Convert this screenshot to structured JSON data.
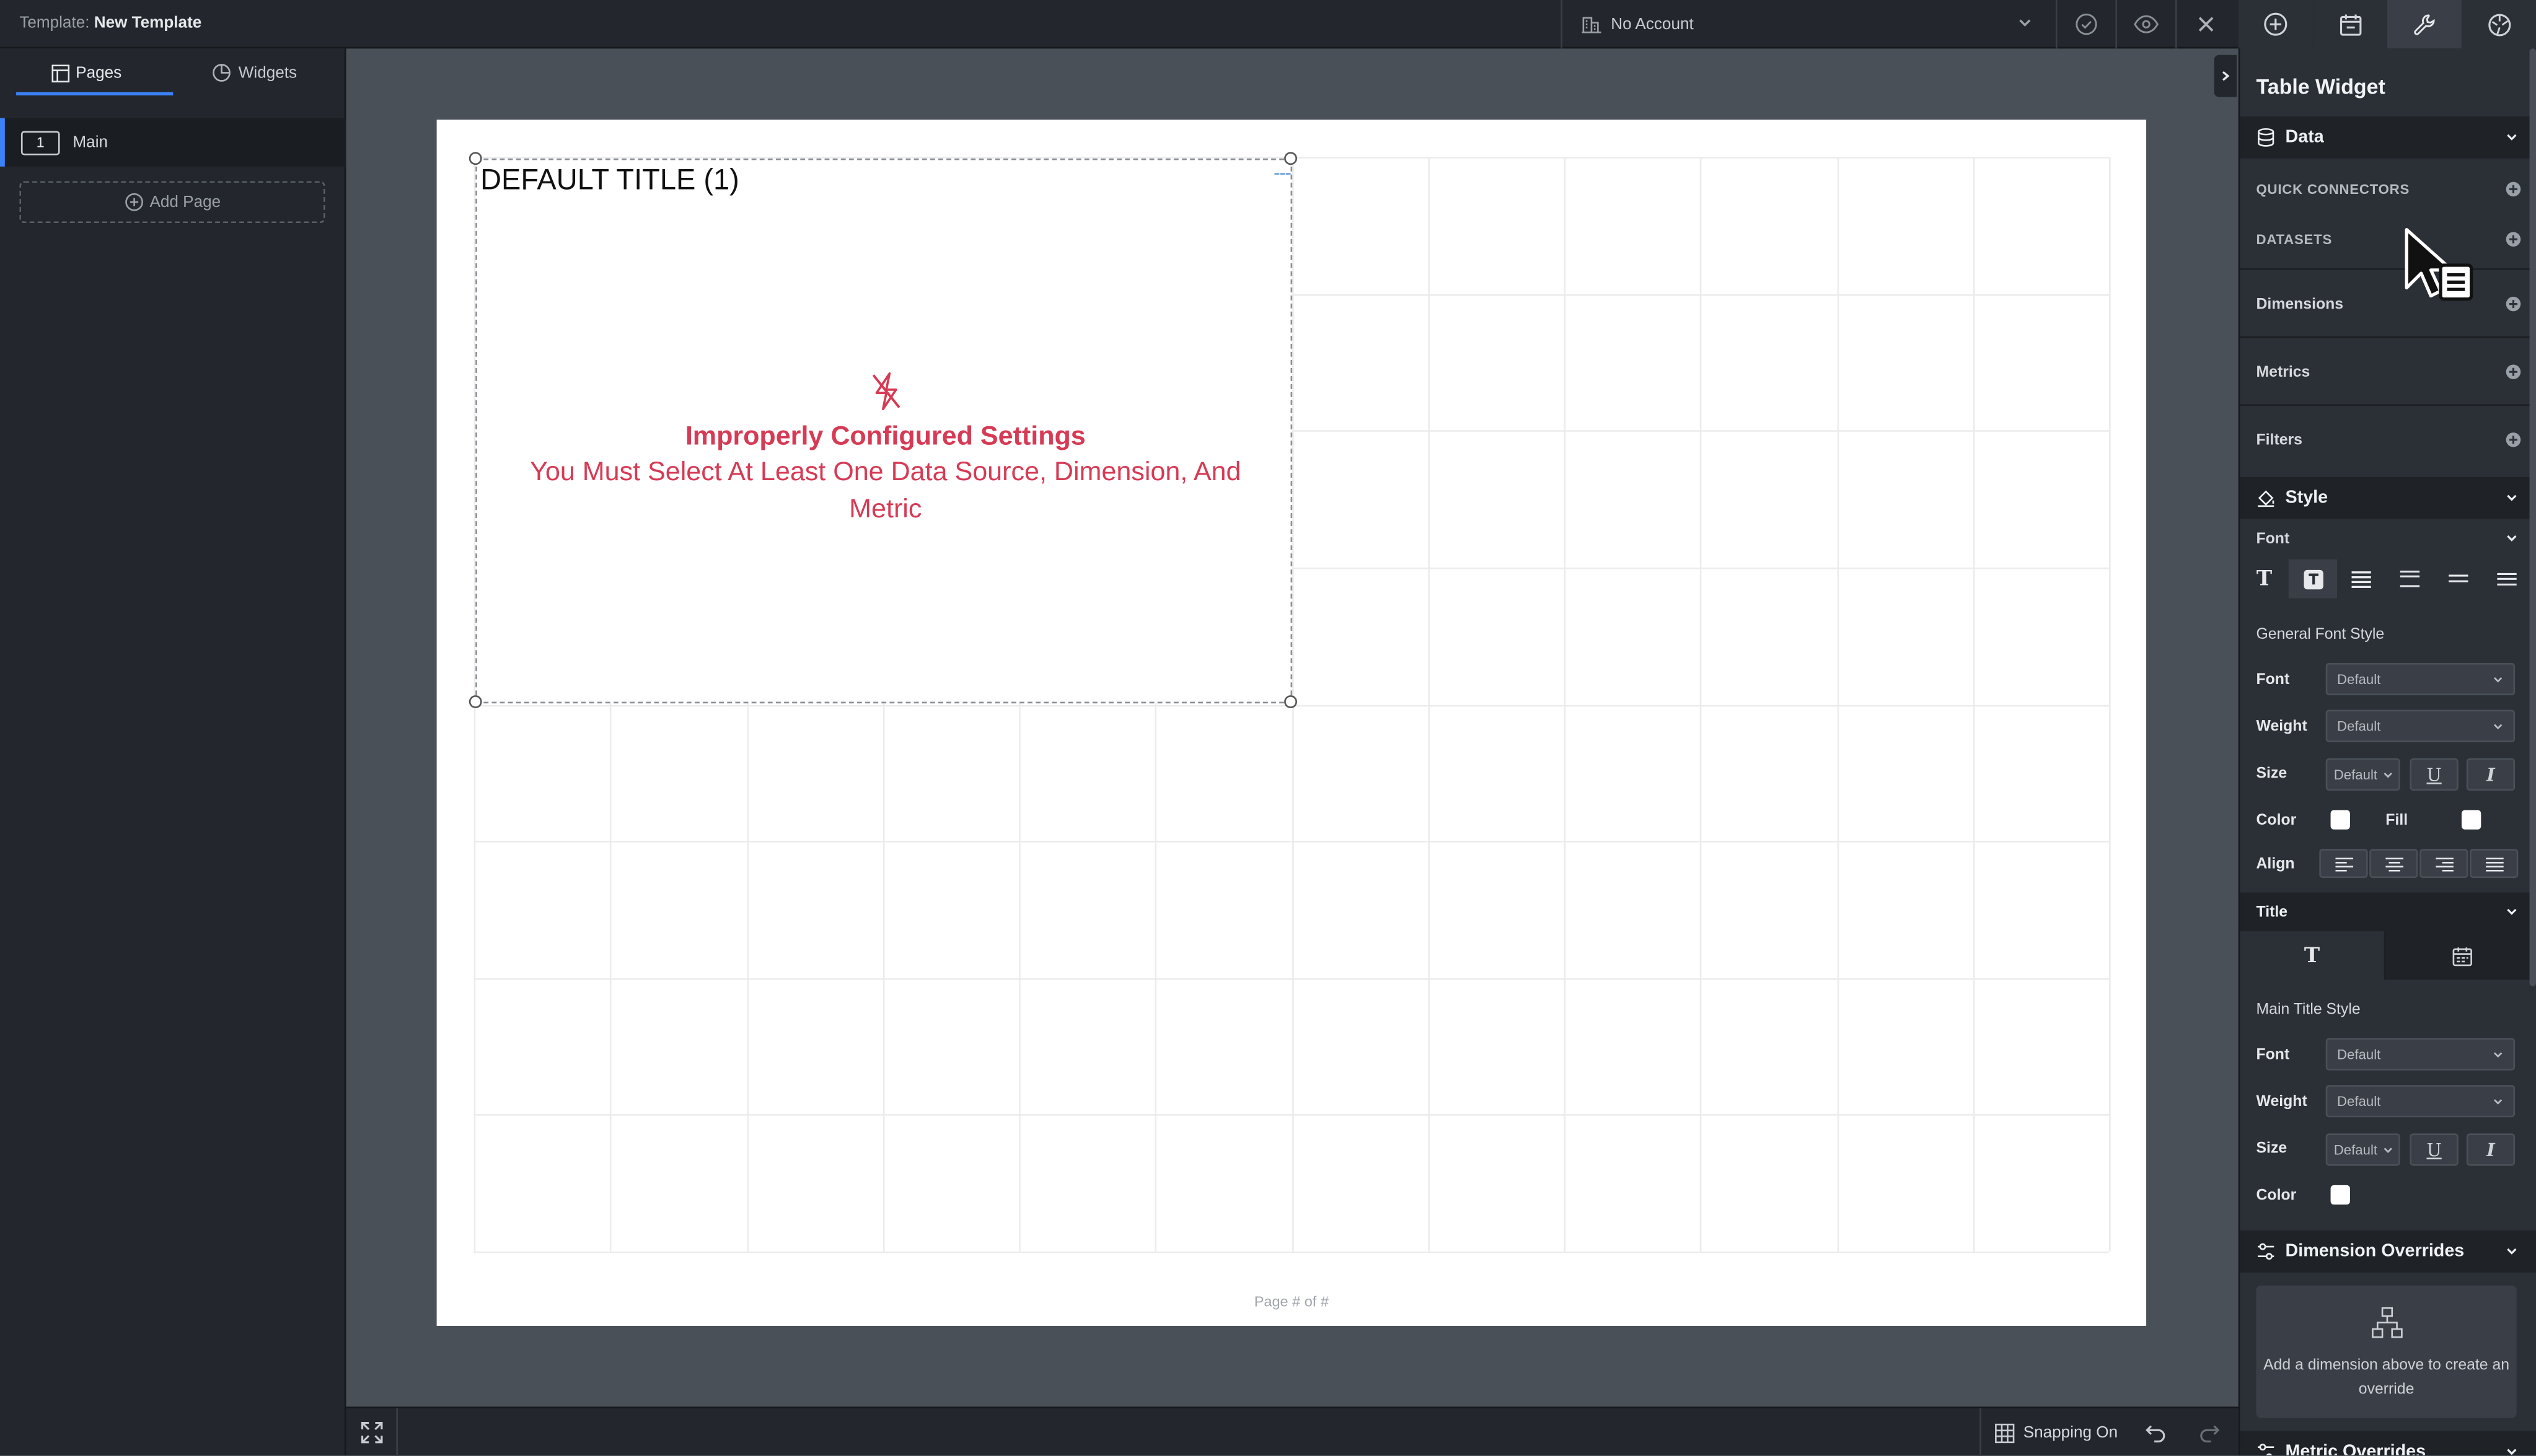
{
  "topbar": {
    "template_label": "Template:",
    "template_name": "New Template",
    "account": "No Account"
  },
  "leftbar": {
    "tabs": [
      "Pages",
      "Widgets"
    ],
    "pages": [
      {
        "number": "1",
        "name": "Main"
      }
    ],
    "add_page": "Add Page"
  },
  "canvas": {
    "widget_title": "DEFAULT TITLE (1)",
    "error_title": "Improperly Configured Settings",
    "error_message": "You Must Select At Least One Data Source, Dimension, And Metric",
    "page_footer": "Page # of #"
  },
  "bottombar": {
    "snapping": "Snapping On"
  },
  "panel": {
    "title": "Table Widget",
    "data_section": "Data",
    "quick_connectors": "QUICK CONNECTORS",
    "datasets": "DATASETS",
    "dimensions": "Dimensions",
    "metrics": "Metrics",
    "filters": "Filters",
    "style_section": "Style",
    "font_subsection": "Font",
    "general_font_style": "General Font Style",
    "font_label": "Font",
    "font_value": "Default",
    "weight_label": "Weight",
    "weight_value": "Default",
    "size_label": "Size",
    "size_value": "Default",
    "color_label": "Color",
    "fill_label": "Fill",
    "align_label": "Align",
    "title_subsection": "Title",
    "main_title_style": "Main Title Style",
    "title_font_label": "Font",
    "title_font_value": "Default",
    "title_weight_label": "Weight",
    "title_weight_value": "Default",
    "title_size_label": "Size",
    "title_size_value": "Default",
    "title_color_label": "Color",
    "dimension_overrides": "Dimension Overrides",
    "override_hint": "Add a dimension above to create an override",
    "metric_overrides": "Metric Overrides",
    "underline_glyph": "U",
    "italic_glyph": "I",
    "colors": {
      "swatch": "#ffffff",
      "error": "#d63a54",
      "accent": "#3b82f6"
    }
  }
}
